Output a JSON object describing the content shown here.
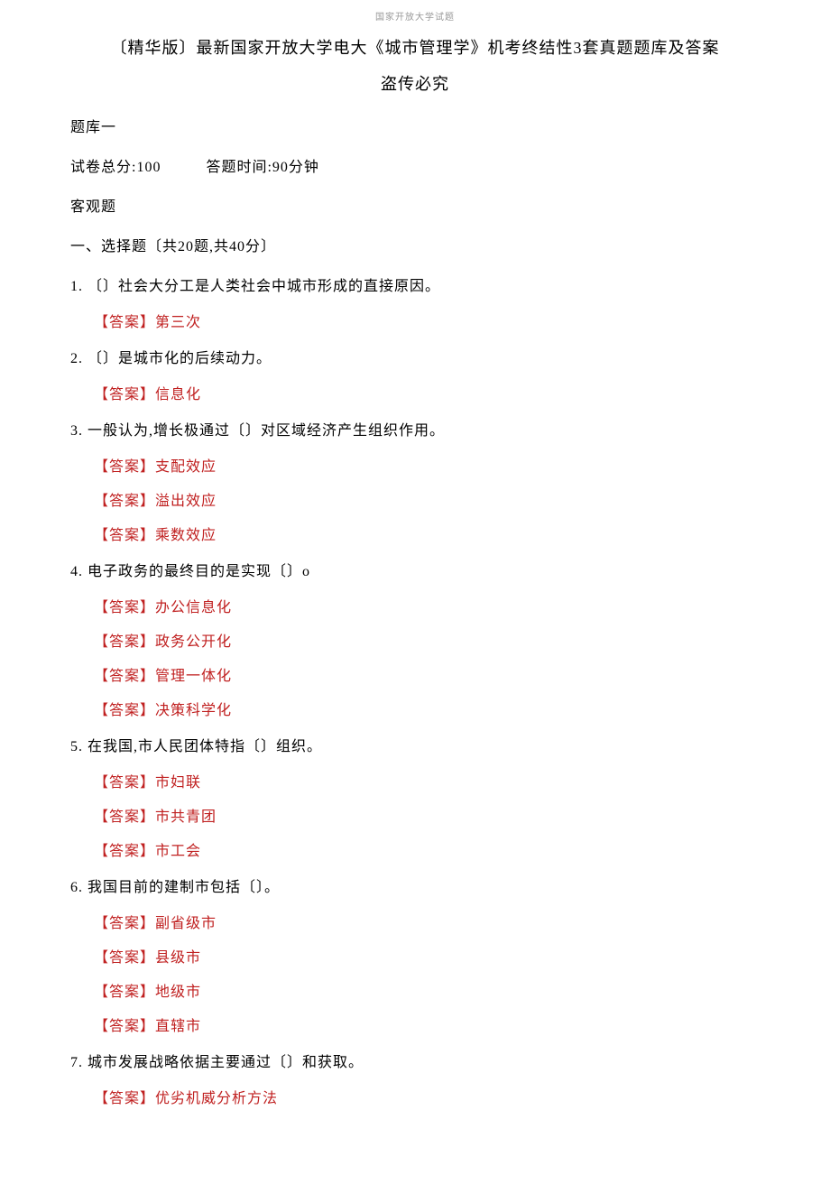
{
  "header_small": "国家开放大学试题",
  "title": "〔精华版〕最新国家开放大学电大《城市管理学》机考终结性3套真题题库及答案",
  "subtitle": "盗传必究",
  "bank_label": "题库一",
  "meta_total": "试卷总分:100",
  "meta_time": "答题时间:90分钟",
  "objective_label": "客观题",
  "section1": "一、选择题〔共20题,共40分〕",
  "q1": "1.  〔〕社会大分工是人类社会中城市形成的直接原因。",
  "a1_1": "【答案】第三次",
  "q2": "2.  〔〕是城市化的后续动力。",
  "a2_1": "【答案】信息化",
  "q3": "3.  一般认为,增长极通过〔〕对区域经济产生组织作用。",
  "a3_1": "【答案】支配效应",
  "a3_2": "【答案】溢出效应",
  "a3_3": "【答案】乘数效应",
  "q4": "4.  电子政务的最终目的是实现〔〕o",
  "a4_1": "【答案】办公信息化",
  "a4_2": "【答案】政务公开化",
  "a4_3": "【答案】管理一体化",
  "a4_4": "【答案】决策科学化",
  "q5": "5.  在我国,市人民团体特指〔〕组织。",
  "a5_1": "【答案】市妇联",
  "a5_2": "【答案】市共青团",
  "a5_3": "【答案】市工会",
  "q6": "6.  我国目前的建制市包括〔〕。",
  "a6_1": "【答案】副省级市",
  "a6_2": "【答案】县级市",
  "a6_3": "【答案】地级市",
  "a6_4": "【答案】直辖市",
  "q7": "7.  城市发展战略依据主要通过〔〕和获取。",
  "a7_1": "【答案】优劣机威分析方法"
}
